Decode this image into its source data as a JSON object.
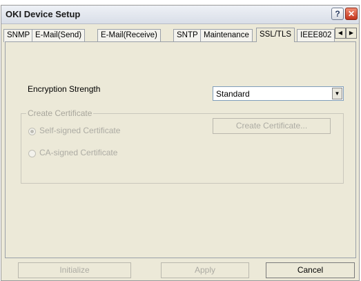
{
  "window": {
    "title": "OKI Device Setup",
    "help_glyph": "?",
    "close_glyph": "✕"
  },
  "tabs": [
    {
      "label": "SNMP",
      "active": false
    },
    {
      "label": "E-Mail(Send)",
      "active": false
    },
    {
      "label": "E-Mail(Receive)",
      "active": false
    },
    {
      "label": "SNTP",
      "active": false
    },
    {
      "label": "Maintenance",
      "active": false
    },
    {
      "label": "SSL/TLS",
      "active": true
    },
    {
      "label": "IEEE802",
      "active": false
    }
  ],
  "tab_scroll": {
    "left_glyph": "◀",
    "right_glyph": "▶"
  },
  "ssl": {
    "encryption_label": "Encryption Strength",
    "encryption_value": "Standard",
    "dropdown_glyph": "▼",
    "create_group_label": "Create Certificate",
    "self_signed_label": "Self-signed Certificate",
    "ca_signed_label": "CA-signed Certificate",
    "create_button_label": "Create Certificate..."
  },
  "footer": {
    "initialize_label": "Initialize",
    "apply_label": "Apply",
    "cancel_label": "Cancel"
  }
}
